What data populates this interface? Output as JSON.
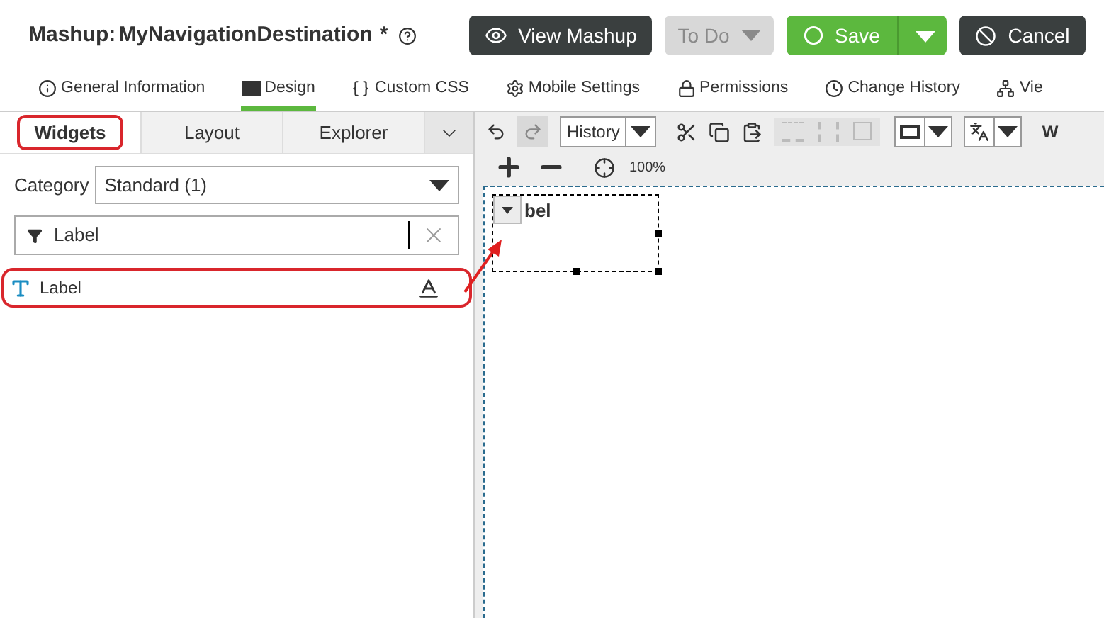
{
  "header": {
    "prefix": "Mashup:",
    "name": "MyNavigationDestination",
    "modified": "*",
    "buttons": [
      {
        "kind": "view",
        "label": "View Mashup"
      },
      {
        "kind": "todo",
        "label": "To Do",
        "disabled": true
      },
      {
        "kind": "save",
        "label": "Save"
      },
      {
        "kind": "cancel",
        "label": "Cancel"
      }
    ]
  },
  "tabs": [
    {
      "kind": "info",
      "label": "General Information",
      "selected": false
    },
    {
      "kind": "design",
      "label": "Design",
      "selected": true
    },
    {
      "kind": "css",
      "label": "Custom CSS",
      "selected": false
    },
    {
      "kind": "mobile",
      "label": "Mobile Settings",
      "selected": false
    },
    {
      "kind": "lock",
      "label": "Permissions",
      "selected": false
    },
    {
      "kind": "history",
      "label": "Change History",
      "selected": false
    },
    {
      "kind": "view",
      "label": "Vie",
      "selected": false
    }
  ],
  "panel_tabs": [
    {
      "label": "Widgets",
      "selected": true
    },
    {
      "label": "Layout",
      "selected": false
    },
    {
      "label": "Explorer",
      "selected": false
    }
  ],
  "category": {
    "label": "Category",
    "value": "Standard (1)"
  },
  "filter": {
    "value": "Label"
  },
  "widgets": [
    {
      "label": "Label"
    }
  ],
  "toolbar": {
    "history": "History",
    "zoom": "100%",
    "cut_off": "W"
  },
  "canvas": {
    "widget_text": "bel"
  }
}
